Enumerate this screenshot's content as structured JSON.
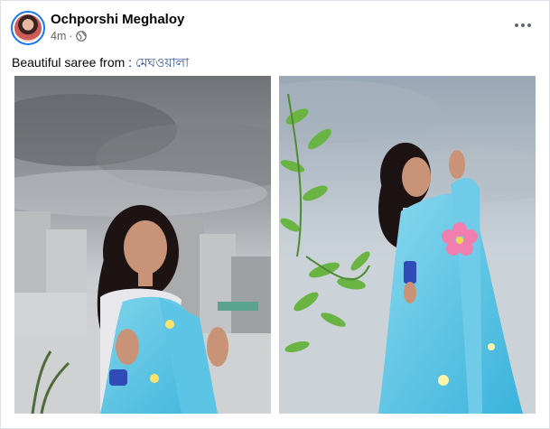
{
  "post": {
    "author": "Ochporshi Meghaloy",
    "time": "4m",
    "separator": "·",
    "privacy_icon": "globe-icon",
    "more_icon": "more-horizontal-icon",
    "caption_text": "Beautiful saree from : ",
    "caption_link": "মেঘওয়ালা",
    "accent_color": "#1877f2",
    "link_color": "#385898"
  },
  "photos": [
    {
      "subject": "woman-in-light-blue-saree-cloudy-sky"
    },
    {
      "subject": "woman-in-light-blue-saree-with-plant"
    }
  ]
}
